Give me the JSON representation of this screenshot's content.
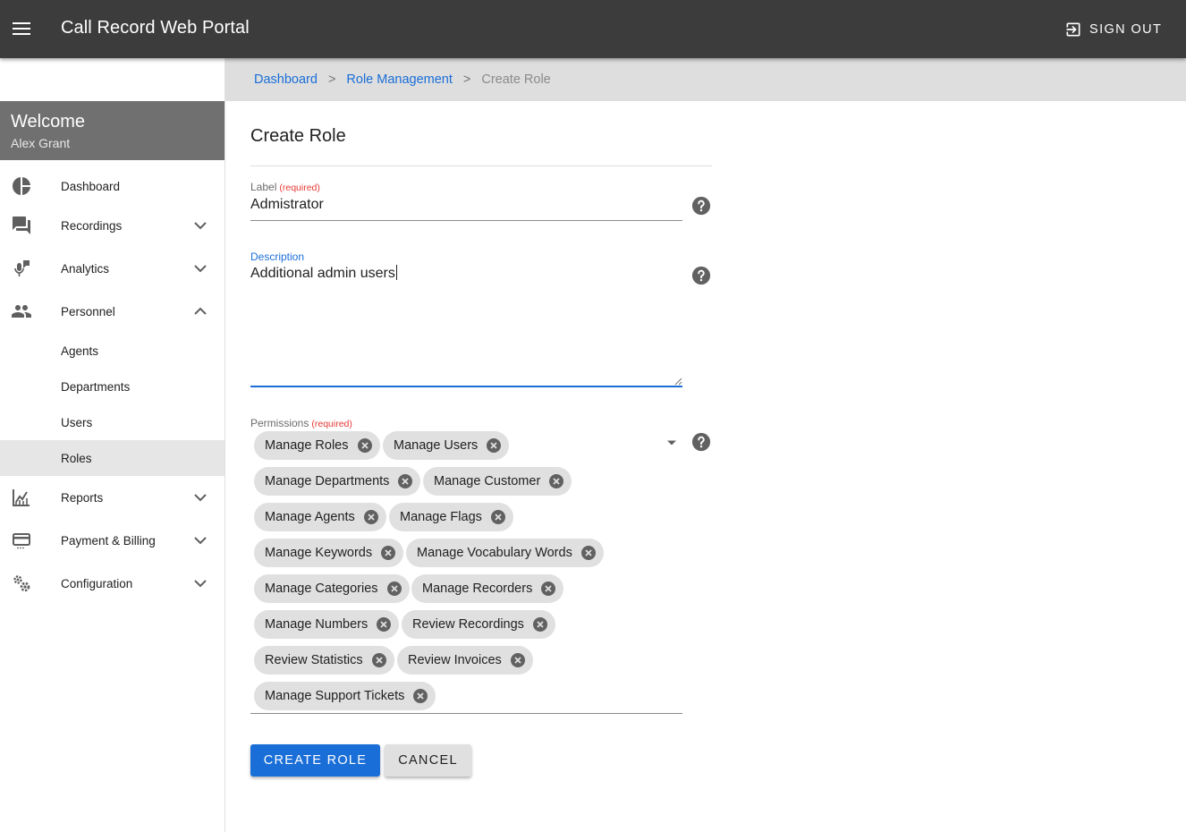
{
  "app": {
    "title": "Call Record Web Portal",
    "sign_out_label": "Sign Out"
  },
  "sidebar": {
    "welcome_title": "Welcome",
    "user_name": "Alex Grant",
    "items": [
      {
        "label": "Dashboard",
        "icon": "pie-chart-icon",
        "expandable": false
      },
      {
        "label": "Recordings",
        "icon": "forum-icon",
        "expandable": true,
        "expanded": false
      },
      {
        "label": "Analytics",
        "icon": "mic-analytics-icon",
        "expandable": true,
        "expanded": false
      },
      {
        "label": "Personnel",
        "icon": "people-icon",
        "expandable": true,
        "expanded": true
      },
      {
        "label": "Reports",
        "icon": "chart-icon",
        "expandable": true,
        "expanded": false
      },
      {
        "label": "Payment & Billing",
        "icon": "credit-card-icon",
        "expandable": true,
        "expanded": false
      },
      {
        "label": "Configuration",
        "icon": "gears-icon",
        "expandable": true,
        "expanded": false
      }
    ],
    "personnel_subitems": [
      "Agents",
      "Departments",
      "Users",
      "Roles"
    ],
    "selected_subitem": "Roles"
  },
  "breadcrumb": {
    "items": [
      "Dashboard",
      "Role Management"
    ],
    "current": "Create Role",
    "separator": ">"
  },
  "form": {
    "title": "Create Role",
    "label_field": {
      "label": "Label",
      "required_text": "(required)",
      "value": "Admistrator"
    },
    "description_field": {
      "label": "Description",
      "value": "Additional admin users"
    },
    "permissions_field": {
      "label": "Permissions",
      "required_text": "(required)",
      "chips": [
        "Manage Roles",
        "Manage Users",
        "Manage Departments",
        "Manage Customer",
        "Manage Agents",
        "Manage Flags",
        "Manage Keywords",
        "Manage Vocabulary Words",
        "Manage Categories",
        "Manage Recorders",
        "Manage Numbers",
        "Review Recordings",
        "Review Statistics",
        "Review Invoices",
        "Manage Support Tickets"
      ]
    },
    "submit_label": "Create Role",
    "cancel_label": "Cancel"
  },
  "colors": {
    "appbar": "#3c3c3c",
    "primary": "#1a6ed8",
    "required": "#e53935",
    "chip": "#e0e0e0"
  }
}
